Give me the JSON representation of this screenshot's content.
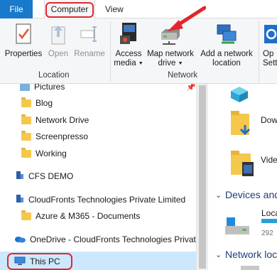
{
  "ribbon_tabs": {
    "file": "File",
    "computer": "Computer",
    "view": "View"
  },
  "ribbon": {
    "location": {
      "label": "Location",
      "properties": "Properties",
      "open": "Open",
      "rename": "Rename"
    },
    "network": {
      "label": "Network",
      "access_media_1": "Access",
      "access_media_2": "media",
      "map_drive_1": "Map network",
      "map_drive_2": "drive",
      "add_location_1": "Add a network",
      "add_location_2": "location"
    },
    "system": {
      "settings_partial_1": "Op",
      "settings_partial_2": "Sett"
    }
  },
  "nav": {
    "items": [
      {
        "label": "Pictures"
      },
      {
        "label": "Blog"
      },
      {
        "label": "Network Drive"
      },
      {
        "label": "Screenpresso"
      },
      {
        "label": "Working"
      },
      {
        "label": "CFS DEMO"
      },
      {
        "label": "CloudFronts Technologies Private Limited"
      },
      {
        "label": "Azure & M365 - Documents"
      },
      {
        "label": "OneDrive - CloudFronts Technologies Private Limited"
      },
      {
        "label": "This PC"
      }
    ]
  },
  "content": {
    "downloads_partial": "Dow",
    "videos_partial": "Vide",
    "devices_header": "Devices and drives",
    "local_disk_partial": "Loca",
    "disk_free_partial": "292",
    "network_header": "Network locations"
  },
  "colors": {
    "accent": "#1979ca",
    "highlight": "#e3262b",
    "selected": "#cce8ff"
  }
}
